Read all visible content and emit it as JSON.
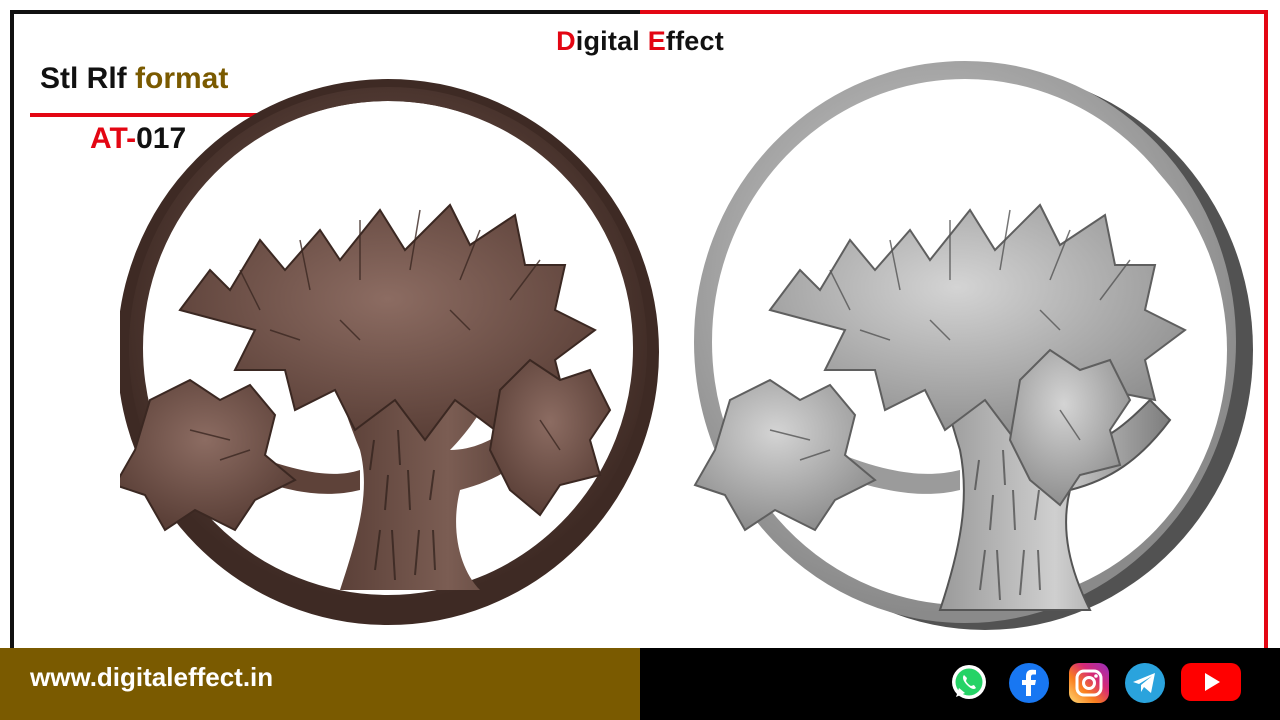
{
  "brand": {
    "part1_initial": "D",
    "part1_rest": "igital ",
    "part2_initial": "E",
    "part2_rest": "ffect"
  },
  "format_label": {
    "part1": "Stl Rlf ",
    "part2": "format"
  },
  "product_code": {
    "prefix": "AT-",
    "number": "017"
  },
  "website": "www.digitaleffect.in",
  "images": [
    {
      "name": "tree-medallion-brown"
    },
    {
      "name": "tree-medallion-grey"
    }
  ],
  "social_icons": [
    "whatsapp-icon",
    "facebook-icon",
    "instagram-icon",
    "telegram-icon",
    "youtube-icon"
  ],
  "colors": {
    "accent_red": "#e30613",
    "olive": "#7a5a00",
    "footer_black": "#000000",
    "wood_brown": "#6b4c43",
    "relief_grey": "#b5b5b5"
  }
}
